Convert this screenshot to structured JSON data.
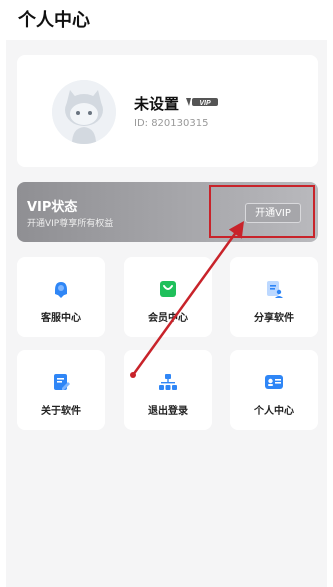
{
  "header": {
    "title": "个人中心"
  },
  "profile": {
    "username": "未设置",
    "vip_badge_text": "VIP",
    "user_id": "ID: 820130315"
  },
  "vip": {
    "title": "VIP状态",
    "subtitle": "开通VIP尊享所有权益",
    "open_button": "开通VIP"
  },
  "grid": {
    "items": [
      {
        "label": "客服中心",
        "icon": "customer-service-icon",
        "color": "#2f86f6"
      },
      {
        "label": "会员中心",
        "icon": "shopping-bag-icon",
        "color": "#1fc05b"
      },
      {
        "label": "分享软件",
        "icon": "share-doc-icon",
        "color": "#2f86f6"
      },
      {
        "label": "关于软件",
        "icon": "edit-doc-icon",
        "color": "#2f86f6"
      },
      {
        "label": "退出登录",
        "icon": "org-chart-icon",
        "color": "#2f86f6"
      },
      {
        "label": "个人中心",
        "icon": "id-card-icon",
        "color": "#2f86f6"
      }
    ]
  },
  "colors": {
    "annotation_red": "#c8232a",
    "accent_blue": "#2f86f6",
    "accent_green": "#1fc05b"
  }
}
